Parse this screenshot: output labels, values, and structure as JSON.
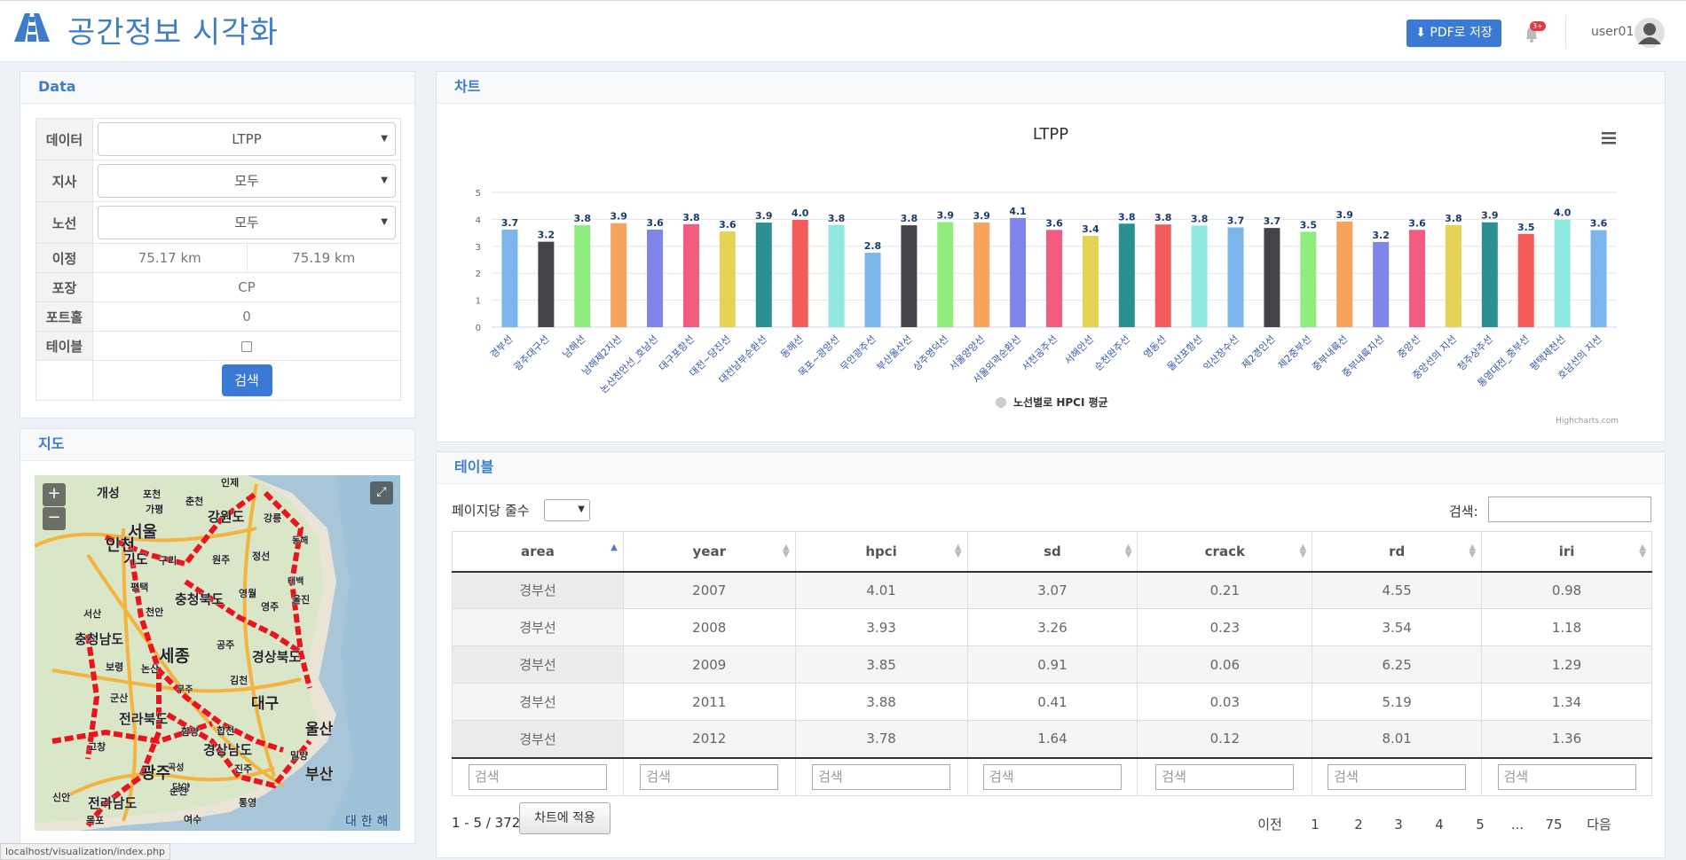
{
  "header": {
    "title": "공간정보 시각화",
    "pdf_button": "PDF로 저장",
    "notification_badge": "3+",
    "username": "user01"
  },
  "data_panel": {
    "title": "Data",
    "rows": {
      "data_label": "데이터",
      "data_value": "LTPP",
      "branch_label": "지사",
      "branch_value": "모두",
      "route_label": "노선",
      "route_value": "모두",
      "distance_label": "이정",
      "distance_from": "75.17 km",
      "distance_to": "75.19 km",
      "pavement_label": "포장",
      "pavement_value": "CP",
      "pothole_label": "포트홀",
      "pothole_value": "0",
      "table_label": "테이블"
    },
    "search_button": "검색"
  },
  "map_panel": {
    "title": "지도",
    "zoom_in": "+",
    "zoom_out": "−",
    "cities": [
      "개성",
      "포천",
      "인제",
      "춘천",
      "가평",
      "강원도",
      "강릉",
      "동해",
      "서울",
      "인천",
      "구리",
      "원주",
      "정선",
      "태백",
      "기도",
      "평택",
      "영월",
      "충청북도",
      "울진",
      "서산",
      "천안",
      "영주",
      "충청남도",
      "세종",
      "공주",
      "경상북도",
      "보령",
      "논산",
      "김천",
      "대구",
      "무주",
      "군산",
      "전라북도",
      "울산",
      "고창",
      "함양",
      "합천",
      "밀양",
      "경상남도",
      "광주",
      "곡성",
      "진주",
      "부산",
      "신안",
      "담양",
      "순천",
      "전라남도",
      "통영",
      "목포",
      "여수",
      "대 한 해"
    ]
  },
  "chart_panel": {
    "title": "차트",
    "credits": "Highcharts.com"
  },
  "chart_data": {
    "type": "bar",
    "title": "LTPP",
    "legend": "노선별로 HPCI 평균",
    "ylim": [
      0,
      5
    ],
    "yticks": [
      0,
      1,
      2,
      3,
      4,
      5
    ],
    "categories": [
      "경부선",
      "광주대구선",
      "남해선",
      "남해제2지선",
      "논산천안선_호남선",
      "대구포항선",
      "대전~당진선",
      "대전남부순환선",
      "동해선",
      "목포~광양선",
      "무안광주선",
      "부산울산선",
      "상주영덕선",
      "서울양양선",
      "서울외곽순환선",
      "서천공주선",
      "서해안선",
      "순천완주선",
      "영동선",
      "울산포항선",
      "익산장수선",
      "제2경인선",
      "제2중부선",
      "중부내륙선",
      "중부내륙지선",
      "중앙선",
      "중앙선의 지선",
      "청주상주선",
      "통영대전_중부선",
      "평택제천선",
      "호남선의 지선"
    ],
    "values": [
      3.7,
      3.2,
      3.8,
      3.9,
      3.6,
      3.8,
      3.6,
      3.9,
      4.0,
      3.8,
      2.8,
      3.8,
      3.9,
      3.9,
      4.1,
      3.6,
      3.4,
      3.8,
      3.8,
      3.8,
      3.7,
      3.7,
      3.5,
      3.9,
      3.2,
      3.6,
      3.8,
      3.9,
      3.5,
      4.0,
      3.6
    ],
    "values_fine": [
      3.62,
      3.17,
      3.78,
      3.86,
      3.62,
      3.82,
      3.55,
      3.88,
      3.98,
      3.79,
      2.76,
      3.78,
      3.9,
      3.88,
      4.05,
      3.61,
      3.39,
      3.84,
      3.81,
      3.77,
      3.7,
      3.68,
      3.54,
      3.92,
      3.16,
      3.61,
      3.78,
      3.89,
      3.46,
      3.99,
      3.6
    ],
    "colors": [
      "#7cb5ec",
      "#434348",
      "#90ed7d",
      "#f7a35c",
      "#8085e9",
      "#f15c80",
      "#e4d354",
      "#2b908f",
      "#f45b5b",
      "#91e8e1"
    ]
  },
  "table_panel": {
    "title": "테이블",
    "rows_per_page_label": "페이지당 줄수",
    "search_label": "검색:",
    "columns": [
      "area",
      "year",
      "hpci",
      "sd",
      "crack",
      "rd",
      "iri"
    ],
    "rows": [
      [
        "경부선",
        "2007",
        "4.01",
        "3.07",
        "0.21",
        "4.55",
        "0.98"
      ],
      [
        "경부선",
        "2008",
        "3.93",
        "3.26",
        "0.23",
        "3.54",
        "1.18"
      ],
      [
        "경부선",
        "2009",
        "3.85",
        "0.91",
        "0.06",
        "6.25",
        "1.29"
      ],
      [
        "경부선",
        "2011",
        "3.88",
        "0.41",
        "0.03",
        "5.19",
        "1.34"
      ],
      [
        "경부선",
        "2012",
        "3.78",
        "1.64",
        "0.12",
        "8.01",
        "1.36"
      ]
    ],
    "footer_placeholder": "검색",
    "info": "1 - 5 / 372",
    "apply_button": "차트에 적용",
    "pagination": {
      "prev": "이전",
      "pages": [
        "1",
        "2",
        "3",
        "4",
        "5",
        "...",
        "75"
      ],
      "next": "다음",
      "active": "1"
    }
  },
  "statusbar": "localhost/visualization/index.php"
}
